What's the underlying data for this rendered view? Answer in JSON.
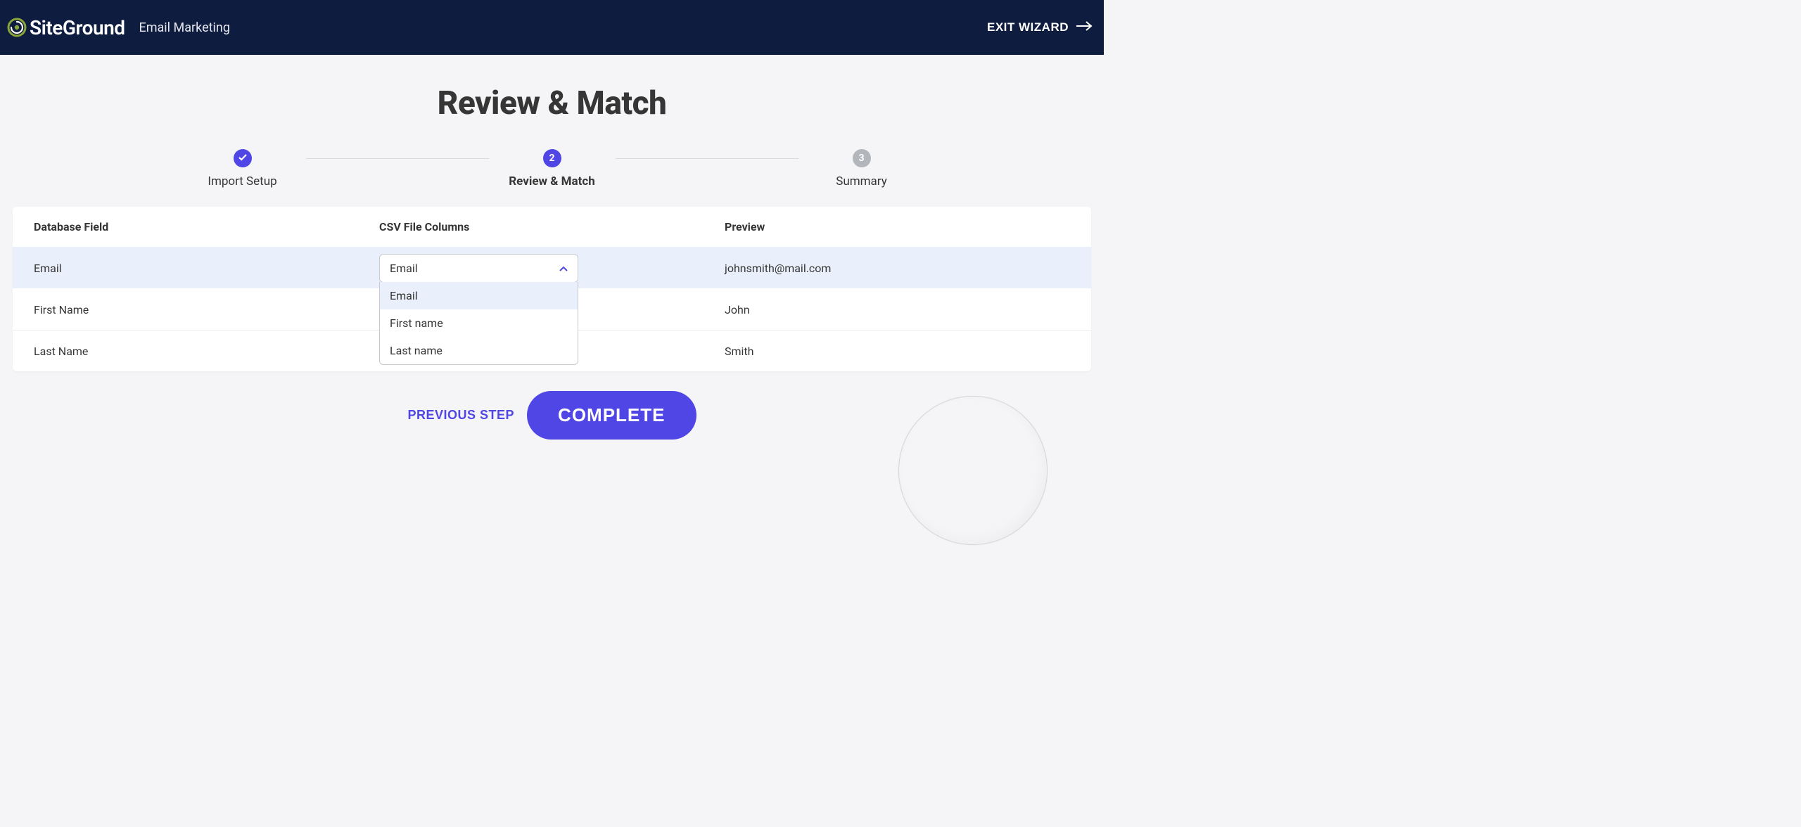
{
  "header": {
    "brand": "SiteGround",
    "subtitle": "Email Marketing",
    "exit_label": "EXIT WIZARD"
  },
  "page_title": "Review & Match",
  "steps": {
    "s1": {
      "label": "Import Setup"
    },
    "s2": {
      "label": "Review & Match",
      "number": "2"
    },
    "s3": {
      "label": "Summary",
      "number": "3"
    }
  },
  "table": {
    "headers": {
      "db": "Database Field",
      "csv": "CSV File Columns",
      "preview": "Preview"
    },
    "rows": {
      "r0": {
        "db": "Email",
        "csv_selected": "Email",
        "preview": "johnsmith@mail.com"
      },
      "r1": {
        "db": "First Name",
        "preview": "John"
      },
      "r2": {
        "db": "Last Name",
        "preview": "Smith"
      }
    }
  },
  "dropdown": {
    "options": {
      "o0": "Email",
      "o1": "First name",
      "o2": "Last name"
    }
  },
  "actions": {
    "previous": "PREVIOUS STEP",
    "complete": "COMPLETE"
  },
  "colors": {
    "primary": "#4f46e5",
    "header_bg": "#0e1c3f"
  }
}
